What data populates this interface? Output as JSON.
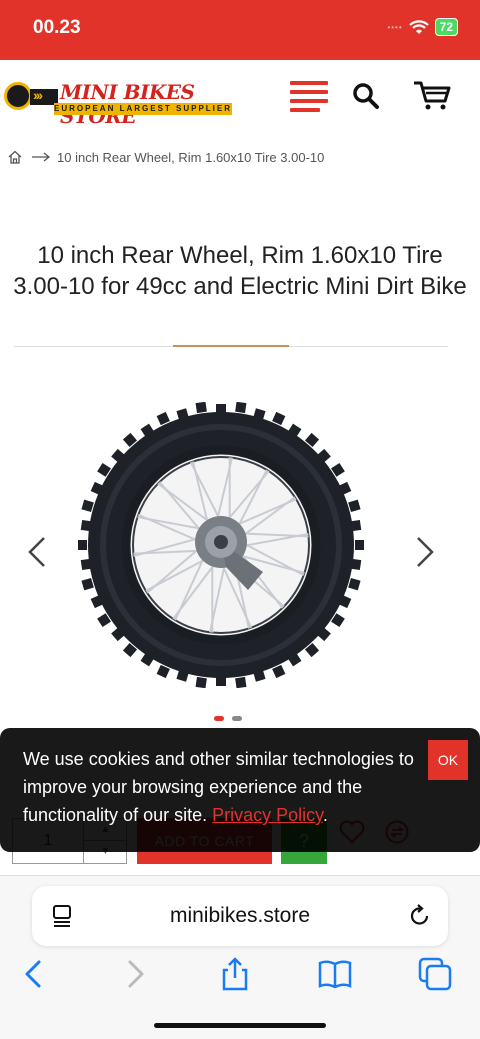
{
  "status_bar": {
    "time": "00.23",
    "signal": "••••",
    "battery": "72"
  },
  "header": {
    "logo_title": "MINI BIKES STORE",
    "logo_subtitle": "EUROPEAN LARGEST SUPPLIER",
    "accent_color": "#e2332b",
    "brand_yellow": "#f0b400"
  },
  "breadcrumb": {
    "home_icon": "home-icon",
    "separator_icon": "arrow-right-icon",
    "current": "10 inch Rear Wheel, Rim 1.60x10 Tire 3.00-10"
  },
  "product": {
    "title": "10 inch Rear Wheel, Rim 1.60x10 Tire 3.00-10 for 49cc and Electric Mini Dirt Bike",
    "gallery_dots": 2,
    "gallery_active_index": 0
  },
  "purchase": {
    "quantity": "1",
    "qty_up": "▲",
    "qty_down": "▼",
    "add_to_cart": "ADD TO CART",
    "question": "?",
    "button_green": "#36a63b"
  },
  "cookie_banner": {
    "text": "We use cookies and other similar technologies to improve your browsing experience and the functionality of our site. ",
    "link": "Privacy Policy",
    "suffix": ".",
    "ok": "OK"
  },
  "browser": {
    "url": "minibikes.store"
  }
}
